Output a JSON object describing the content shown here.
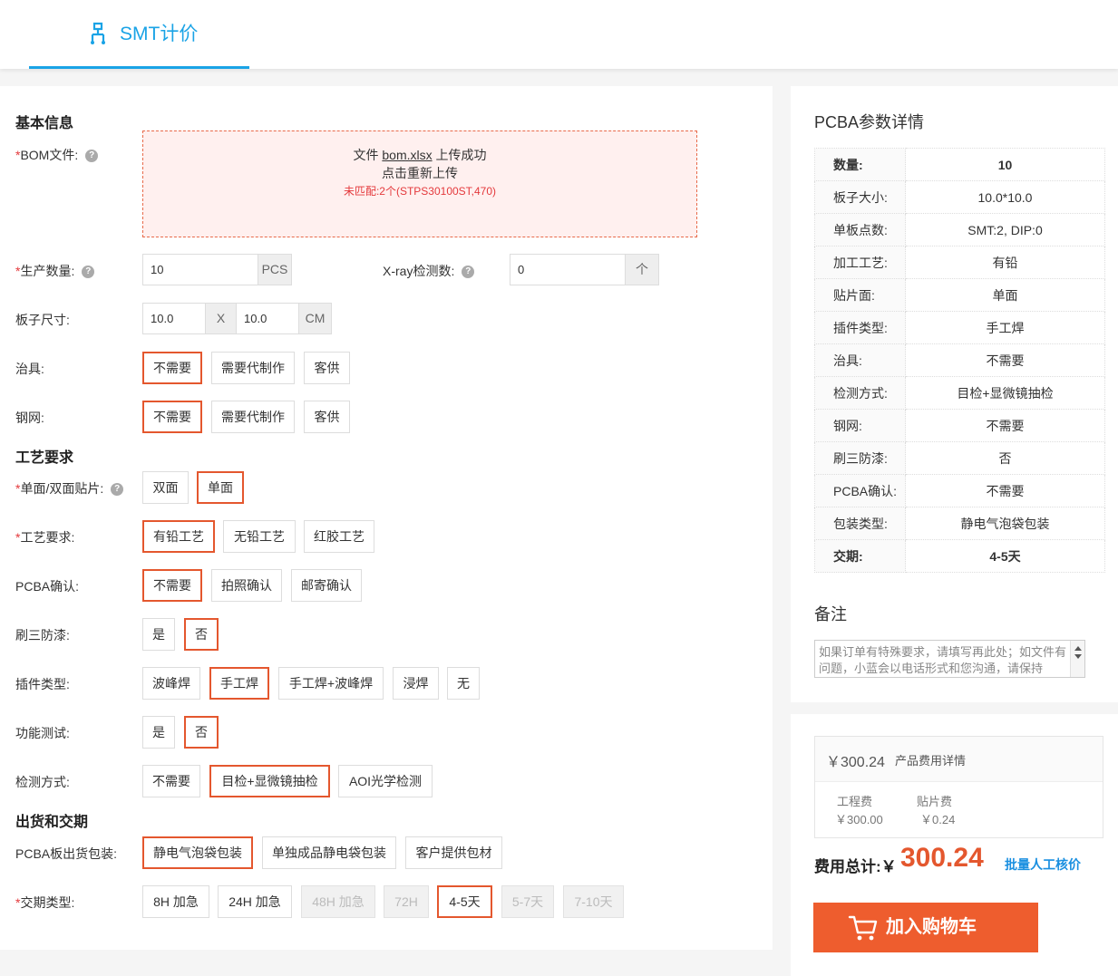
{
  "header": {
    "tab_label": "SMT计价"
  },
  "colors": {
    "accent": "#1aa3e6",
    "selected_border": "#e4572e",
    "price": "#e4572e",
    "cart_button": "#ee5d2e",
    "required": "#e4393c"
  },
  "form": {
    "section_basic": "基本信息",
    "section_process": "工艺要求",
    "section_delivery": "出货和交期",
    "required_mark": "*",
    "help_icon": "?",
    "bom": {
      "label": "BOM文件:",
      "prefix": "文件",
      "file_name": "bom.xlsx",
      "suffix": "上传成功",
      "reupload": "点击重新上传",
      "unmatched": "未匹配:2个(STPS30100ST,470)"
    },
    "quantity": {
      "label": "生产数量:",
      "value": "10",
      "unit": "PCS"
    },
    "xray": {
      "label": "X-ray检测数:",
      "value": "0",
      "unit": "个"
    },
    "board_size": {
      "label": "板子尺寸:",
      "width": "10.0",
      "sep": "X",
      "height": "10.0",
      "unit": "CM"
    },
    "jig": {
      "label": "治具:",
      "options": [
        "不需要",
        "需要代制作",
        "客供"
      ],
      "selected": "不需要"
    },
    "stencil": {
      "label": "钢网:",
      "options": [
        "不需要",
        "需要代制作",
        "客供"
      ],
      "selected": "不需要"
    },
    "side": {
      "label": "单面/双面贴片:",
      "options": [
        "双面",
        "单面"
      ],
      "selected": "单面"
    },
    "process": {
      "label": "工艺要求:",
      "options": [
        "有铅工艺",
        "无铅工艺",
        "红胶工艺"
      ],
      "selected": "有铅工艺"
    },
    "pcba_confirm": {
      "label": "PCBA确认:",
      "options": [
        "不需要",
        "拍照确认",
        "邮寄确认"
      ],
      "selected": "不需要"
    },
    "coating": {
      "label": "刷三防漆:",
      "options": [
        "是",
        "否"
      ],
      "selected": "否"
    },
    "plugin": {
      "label": "插件类型:",
      "options": [
        "波峰焊",
        "手工焊",
        "手工焊+波峰焊",
        "浸焊",
        "无"
      ],
      "selected": "手工焊"
    },
    "func_test": {
      "label": "功能测试:",
      "options": [
        "是",
        "否"
      ],
      "selected": "否"
    },
    "inspection": {
      "label": "检测方式:",
      "options": [
        "不需要",
        "目检+显微镜抽检",
        "AOI光学检测"
      ],
      "selected": "目检+显微镜抽检"
    },
    "packaging": {
      "label": "PCBA板出货包装:",
      "options": [
        "静电气泡袋包装",
        "单独成品静电袋包装",
        "客户提供包材"
      ],
      "selected": "静电气泡袋包装"
    },
    "delivery": {
      "label": "交期类型:",
      "options": [
        "8H 加急",
        "24H 加急",
        "48H 加急",
        "72H",
        "4-5天",
        "5-7天",
        "7-10天"
      ],
      "selected": "4-5天",
      "disabled": [
        "48H 加急",
        "72H",
        "5-7天",
        "7-10天"
      ]
    }
  },
  "summary": {
    "title": "PCBA参数详情",
    "rows": [
      {
        "key": "数量:",
        "value": "10",
        "bold": true
      },
      {
        "key": "板子大小:",
        "value": "10.0*10.0"
      },
      {
        "key": "单板点数:",
        "value": "SMT:2, DIP:0"
      },
      {
        "key": "加工工艺:",
        "value": "有铅"
      },
      {
        "key": "贴片面:",
        "value": "单面"
      },
      {
        "key": "插件类型:",
        "value": "手工焊"
      },
      {
        "key": "治具:",
        "value": "不需要"
      },
      {
        "key": "检测方式:",
        "value": "目检+显微镜抽检"
      },
      {
        "key": "钢网:",
        "value": "不需要"
      },
      {
        "key": "刷三防漆:",
        "value": "否"
      },
      {
        "key": "PCBA确认:",
        "value": "不需要"
      },
      {
        "key": "包装类型:",
        "value": "静电气泡袋包装"
      },
      {
        "key": "交期:",
        "value": "4-5天",
        "bold": true
      }
    ],
    "remark_title": "备注",
    "remark_placeholder": "如果订单有特殊要求，请填写再此处；如文件有问题，小蓝会以电话形式和您沟通，请保持"
  },
  "fees": {
    "total_amount": "￥300.24",
    "detail_label": "产品费用详情",
    "engineering_label": "工程费",
    "engineering_value": "￥300.00",
    "smt_label": "贴片费",
    "smt_value": "￥0.24",
    "total_label": "费用总计:",
    "currency": "￥",
    "total_value": "300.24",
    "batch_link": "批量人工核价",
    "cart_button": "加入购物车"
  }
}
